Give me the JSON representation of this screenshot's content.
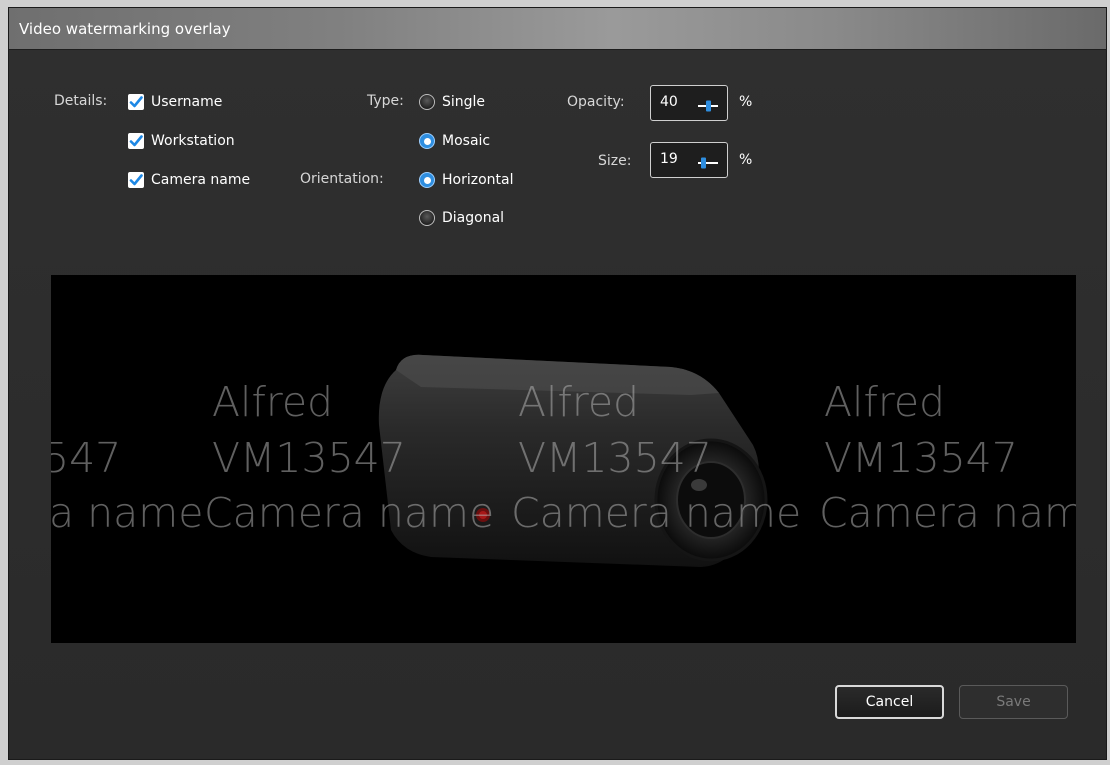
{
  "window": {
    "title": "Video watermarking overlay"
  },
  "details": {
    "label": "Details:",
    "items": [
      {
        "label": "Username",
        "checked": true
      },
      {
        "label": "Workstation",
        "checked": true
      },
      {
        "label": "Camera name",
        "checked": true
      }
    ]
  },
  "type": {
    "label": "Type:",
    "options": [
      {
        "label": "Single",
        "selected": false
      },
      {
        "label": "Mosaic",
        "selected": true
      }
    ]
  },
  "orientation": {
    "label": "Orientation:",
    "options": [
      {
        "label": "Horizontal",
        "selected": true
      },
      {
        "label": "Diagonal",
        "selected": false
      }
    ]
  },
  "opacity": {
    "label": "Opacity:",
    "value": "40",
    "unit": "%"
  },
  "size": {
    "label": "Size:",
    "value": "19",
    "unit": "%"
  },
  "preview": {
    "rows": [
      [
        "Alfred",
        "Alfred",
        "Alfred"
      ],
      [
        "547",
        "VM13547",
        "VM13547",
        "VM13547"
      ],
      [
        "a name",
        "Camera name",
        "Camera name",
        "Camera nam"
      ]
    ]
  },
  "buttons": {
    "cancel": "Cancel",
    "save": "Save"
  },
  "colors": {
    "accent": "#2e8ee0",
    "check": "#1e88e5",
    "background": "#2b2b2b"
  }
}
